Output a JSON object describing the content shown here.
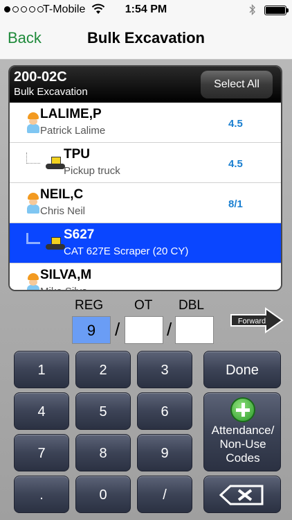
{
  "status_bar": {
    "carrier": "T-Mobile",
    "time": "1:54 PM"
  },
  "nav": {
    "back_label": "Back",
    "title": "Bulk Excavation"
  },
  "list": {
    "job_code": "200-02C",
    "job_name": "Bulk Excavation",
    "select_all_label": "Select All",
    "rows": [
      {
        "name": "LALIME,P",
        "sub": "Patrick Lalime",
        "hours": "4.5",
        "icon": "worker-icon"
      },
      {
        "name": "TPU",
        "sub": "Pickup truck",
        "hours": "4.5",
        "icon": "equipment-icon"
      },
      {
        "name": "NEIL,C",
        "sub": "Chris Neil",
        "hours": "8/1",
        "icon": "worker-icon"
      },
      {
        "name": "S627",
        "sub": "CAT 627E Scraper (20 CY)",
        "hours": "",
        "icon": "equipment-icon"
      },
      {
        "name": "SILVA,M",
        "sub": "Mike Silva",
        "hours": "",
        "icon": "worker-icon"
      }
    ]
  },
  "entry": {
    "reg_label": "REG",
    "ot_label": "OT",
    "dbl_label": "DBL",
    "reg_value": "9",
    "ot_value": "",
    "dbl_value": "",
    "separator": "/",
    "forward_label": "Forward"
  },
  "keypad": {
    "keys": [
      "1",
      "2",
      "3",
      "4",
      "5",
      "6",
      "7",
      "8",
      "9",
      ".",
      "0",
      "/"
    ],
    "done_label": "Done",
    "attendance_label_1": "Attendance/",
    "attendance_label_2": "Non-Use",
    "attendance_label_3": "Codes"
  }
}
